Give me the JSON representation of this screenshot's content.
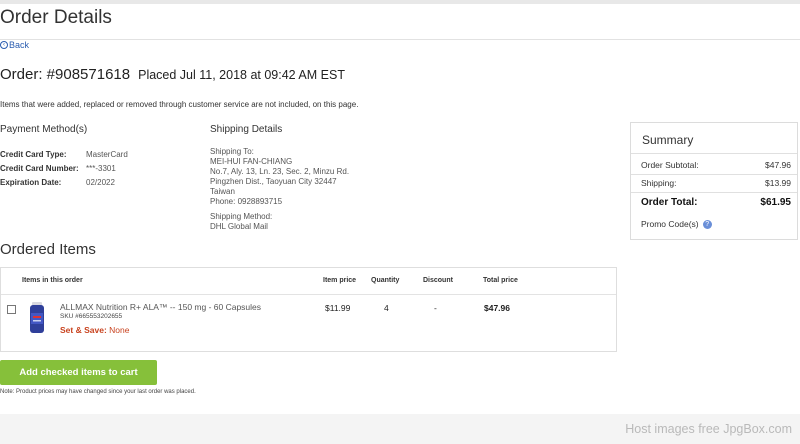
{
  "page": {
    "title": "Order Details"
  },
  "nav": {
    "back_label": "Back"
  },
  "order": {
    "number_text": "Order: #908571618",
    "placed_text": "Placed Jul 11, 2018 at 09:42 AM EST",
    "notice": "Items that were added, replaced or removed through customer service are not included, on this page."
  },
  "payment": {
    "title": "Payment Method(s)",
    "rows": [
      {
        "label": "Credit Card Type:",
        "value": "MasterCard"
      },
      {
        "label": "Credit Card Number:",
        "value": "***-3301"
      },
      {
        "label": "Expiration Date:",
        "value": "02/2022"
      }
    ]
  },
  "shipping": {
    "title": "Shipping Details",
    "to_label": "Shipping To:",
    "name": "MEI-HUI FAN-CHIANG",
    "address1": "No.7, Aly. 13, Ln. 23, Sec. 2, Minzu Rd.",
    "address2": "Pingzhen Dist., Taoyuan City 32447",
    "country": "Taiwan",
    "phone": "Phone: 0928893715",
    "method_label": "Shipping Method:",
    "method": "DHL Global Mail"
  },
  "summary": {
    "title": "Summary",
    "subtotal_label": "Order Subtotal:",
    "subtotal": "$47.96",
    "shipping_label": "Shipping:",
    "shipping": "$13.99",
    "total_label": "Order Total:",
    "total": "$61.95",
    "promo_label": "Promo Code(s)",
    "promo_icon": "?"
  },
  "items": {
    "title": "Ordered Items",
    "headers": [
      "Items in this order",
      "Item price",
      "Quantity",
      "Discount",
      "Total price"
    ],
    "rows": [
      {
        "name": "ALLMAX Nutrition R+ ALA™ -- 150 mg - 60 Capsules",
        "sku": "SKU #665553202655",
        "setsave_label": "Set & Save:",
        "setsave_value": "None",
        "price": "$11.99",
        "quantity": "4",
        "discount": "-",
        "total": "$47.96"
      }
    ]
  },
  "actions": {
    "add_to_cart": "Add checked items to cart",
    "note": "Note: Product prices may have changed since your last order was placed."
  },
  "footer": {
    "watermark": "Host images free JpgBox.com"
  },
  "colors": {
    "accent_green": "#86c03a",
    "link_blue": "#2a5db0",
    "setsave_red": "#c8421e"
  }
}
